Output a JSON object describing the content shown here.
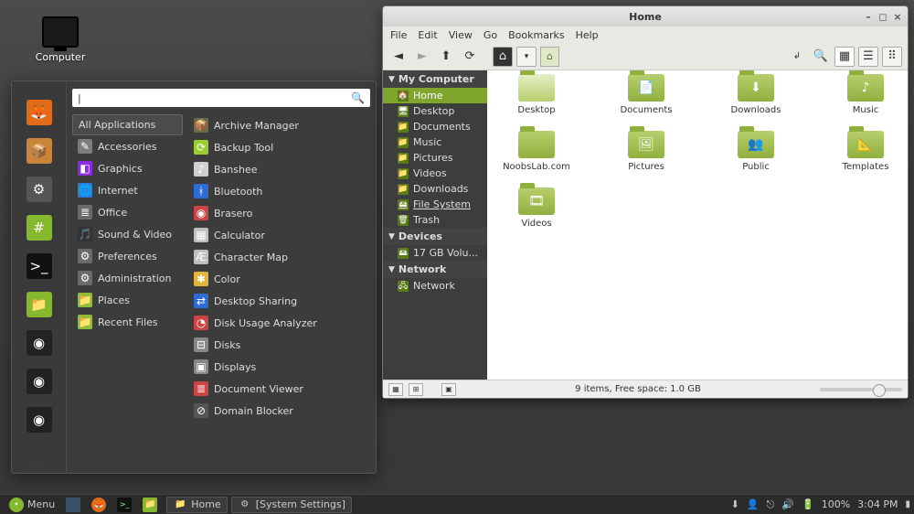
{
  "desktop": {
    "computer_label": "Computer"
  },
  "menu": {
    "search_placeholder": "",
    "all_apps_label": "All Applications",
    "categories": [
      {
        "label": "Accessories",
        "color": "#7d7d7d",
        "glyph": "✎"
      },
      {
        "label": "Graphics",
        "color": "#8a2be2",
        "glyph": "◧"
      },
      {
        "label": "Internet",
        "color": "#2e7bd6",
        "glyph": "🌐"
      },
      {
        "label": "Office",
        "color": "#6a6a6a",
        "glyph": "≣"
      },
      {
        "label": "Sound & Video",
        "color": "#333",
        "glyph": "🎵"
      },
      {
        "label": "Preferences",
        "color": "#6a6a6a",
        "glyph": "⚙"
      },
      {
        "label": "Administration",
        "color": "#6a6a6a",
        "glyph": "⚙"
      },
      {
        "label": "Places",
        "color": "#8fbc3a",
        "glyph": "📁"
      },
      {
        "label": "Recent Files",
        "color": "#8fbc3a",
        "glyph": "📁"
      }
    ],
    "apps": [
      {
        "label": "Archive Manager",
        "color": "#6b6b4a",
        "glyph": "📦"
      },
      {
        "label": "Backup Tool",
        "color": "#9acd32",
        "glyph": "⟳"
      },
      {
        "label": "Banshee",
        "color": "#d0d0d0",
        "glyph": "♪"
      },
      {
        "label": "Bluetooth",
        "color": "#2f6bd6",
        "glyph": "ᚼ"
      },
      {
        "label": "Brasero",
        "color": "#c44",
        "glyph": "◉"
      },
      {
        "label": "Calculator",
        "color": "#bfbfbf",
        "glyph": "▦"
      },
      {
        "label": "Character Map",
        "color": "#bfbfbf",
        "glyph": "Æ"
      },
      {
        "label": "Color",
        "color": "#e2b53a",
        "glyph": "✱"
      },
      {
        "label": "Desktop Sharing",
        "color": "#2f6bd6",
        "glyph": "⇄"
      },
      {
        "label": "Disk Usage Analyzer",
        "color": "#c44",
        "glyph": "◔"
      },
      {
        "label": "Disks",
        "color": "#888",
        "glyph": "⊟"
      },
      {
        "label": "Displays",
        "color": "#888",
        "glyph": "▣"
      },
      {
        "label": "Document Viewer",
        "color": "#c44",
        "glyph": "≣"
      },
      {
        "label": "Domain Blocker",
        "color": "#555",
        "glyph": "⊘"
      }
    ],
    "favorites": [
      {
        "name": "firefox",
        "color": "#e26b1a",
        "glyph": "🦊"
      },
      {
        "name": "software",
        "color": "#c9863a",
        "glyph": "📦"
      },
      {
        "name": "settings",
        "color": "#555",
        "glyph": "⚙"
      },
      {
        "name": "updates",
        "color": "#86b82f",
        "glyph": "#"
      },
      {
        "name": "terminal",
        "color": "#111",
        "glyph": ">_"
      },
      {
        "name": "files",
        "color": "#86b82f",
        "glyph": "📁"
      },
      {
        "name": "media1",
        "color": "#222",
        "glyph": "◉"
      },
      {
        "name": "media2",
        "color": "#222",
        "glyph": "◉"
      },
      {
        "name": "media3",
        "color": "#222",
        "glyph": "◉"
      }
    ]
  },
  "fm": {
    "title": "Home",
    "menus": [
      "File",
      "Edit",
      "View",
      "Go",
      "Bookmarks",
      "Help"
    ],
    "sidebar": {
      "sections": [
        {
          "title": "My Computer",
          "items": [
            {
              "label": "Home",
              "icon": "🏠",
              "sel": true
            },
            {
              "label": "Desktop",
              "icon": "🖥"
            },
            {
              "label": "Documents",
              "icon": "📁"
            },
            {
              "label": "Music",
              "icon": "📁"
            },
            {
              "label": "Pictures",
              "icon": "📁"
            },
            {
              "label": "Videos",
              "icon": "📁"
            },
            {
              "label": "Downloads",
              "icon": "📁"
            },
            {
              "label": "File System",
              "icon": "🖴",
              "u": true
            },
            {
              "label": "Trash",
              "icon": "🗑"
            }
          ]
        },
        {
          "title": "Devices",
          "items": [
            {
              "label": "17 GB Volu...",
              "icon": "🖴"
            }
          ]
        },
        {
          "title": "Network",
          "items": [
            {
              "label": "Network",
              "icon": "🖧"
            }
          ]
        }
      ]
    },
    "items": [
      {
        "label": "Desktop",
        "kind": "folder-open",
        "badge": ""
      },
      {
        "label": "Documents",
        "kind": "folder",
        "badge": "📄"
      },
      {
        "label": "Downloads",
        "kind": "folder",
        "badge": "⬇"
      },
      {
        "label": "Music",
        "kind": "folder",
        "badge": "♪"
      },
      {
        "label": "NoobsLab.com",
        "kind": "folder",
        "badge": ""
      },
      {
        "label": "Pictures",
        "kind": "folder",
        "badge": "🖼"
      },
      {
        "label": "Public",
        "kind": "folder",
        "badge": "👥"
      },
      {
        "label": "Templates",
        "kind": "folder",
        "badge": "📐"
      },
      {
        "label": "Videos",
        "kind": "folder",
        "badge": "🎞"
      }
    ],
    "status": "9 items, Free space: 1.0 GB",
    "path_home_glyph": "⌂"
  },
  "taskbar": {
    "menu_label": "Menu",
    "tasks": [
      {
        "label": "Home",
        "icon": "📁"
      },
      {
        "label": "[System Settings]",
        "icon": "⚙"
      }
    ],
    "battery": "100%",
    "clock": "3:04 PM"
  }
}
